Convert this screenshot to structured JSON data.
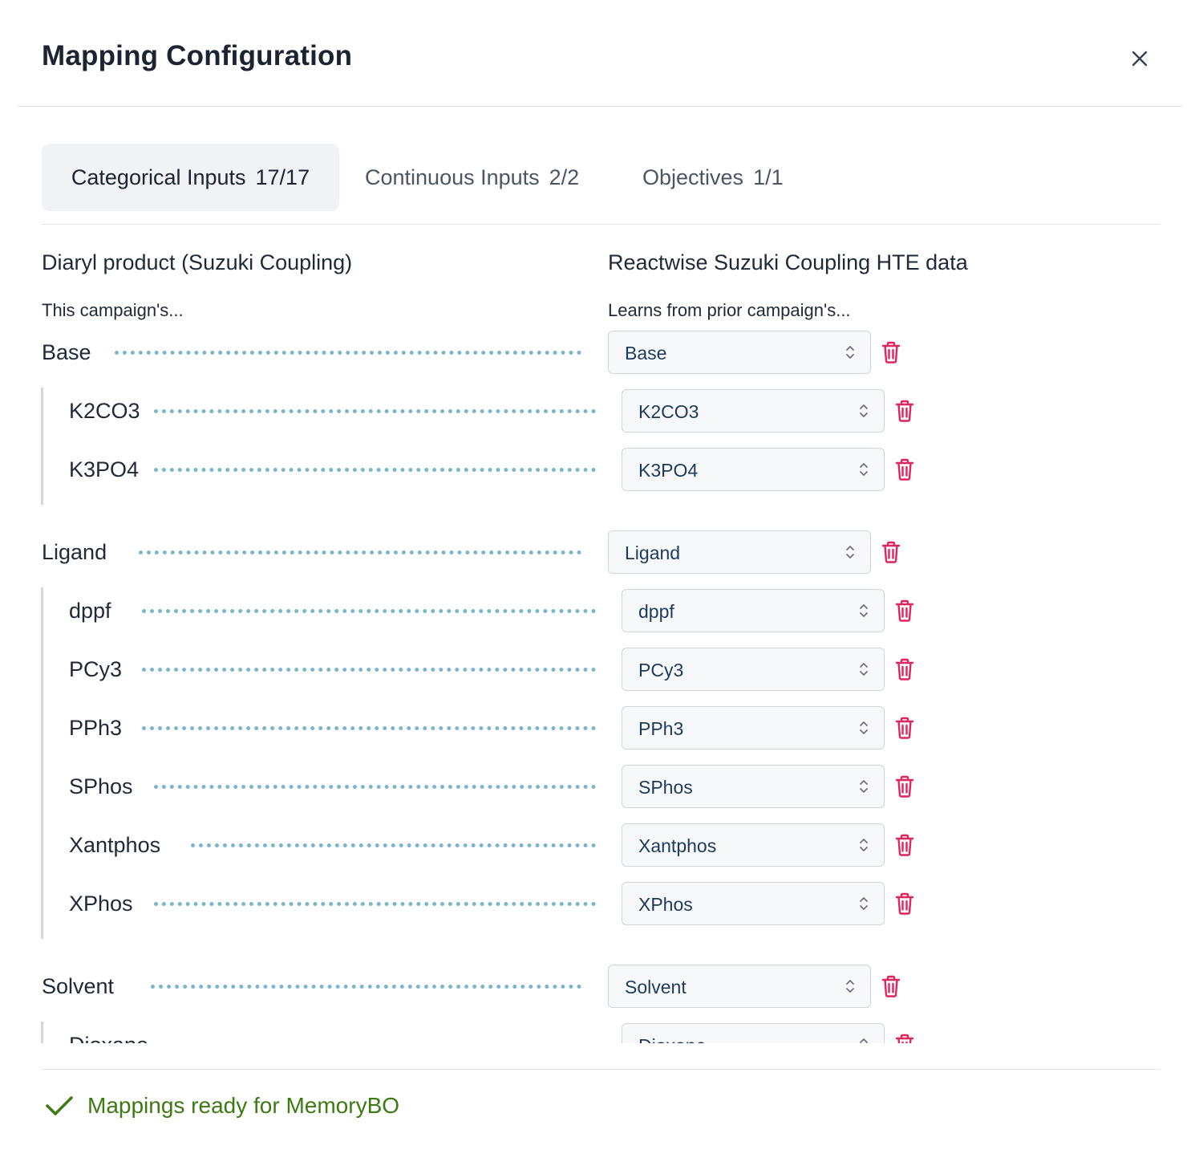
{
  "dialog": {
    "title": "Mapping Configuration",
    "close_icon": "close-icon"
  },
  "tabs": [
    {
      "label": "Categorical Inputs",
      "count": "17/17",
      "active": true
    },
    {
      "label": "Continuous Inputs",
      "count": "2/2",
      "active": false
    },
    {
      "label": "Objectives",
      "count": "1/1",
      "active": false
    }
  ],
  "left_column": {
    "title": "Diaryl product (Suzuki Coupling)",
    "subtitle": "This campaign's..."
  },
  "right_column": {
    "title": "Reactwise Suzuki Coupling HTE data",
    "subtitle": "Learns from prior campaign's..."
  },
  "groups": [
    {
      "label": "Base",
      "mapped": "Base",
      "items": [
        {
          "label": "K2CO3",
          "mapped": "K2CO3"
        },
        {
          "label": "K3PO4",
          "mapped": "K3PO4"
        }
      ]
    },
    {
      "label": "Ligand",
      "mapped": "Ligand",
      "items": [
        {
          "label": "dppf",
          "mapped": "dppf"
        },
        {
          "label": "PCy3",
          "mapped": "PCy3"
        },
        {
          "label": "PPh3",
          "mapped": "PPh3"
        },
        {
          "label": "SPhos",
          "mapped": "SPhos"
        },
        {
          "label": "Xantphos",
          "mapped": "Xantphos"
        },
        {
          "label": "XPhos",
          "mapped": "XPhos"
        }
      ]
    },
    {
      "label": "Solvent",
      "mapped": "Solvent",
      "items": [
        {
          "label": "Dioxane",
          "mapped": "Dioxane"
        }
      ]
    }
  ],
  "footer": {
    "status_text": "Mappings ready for MemoryBO",
    "status_icon": "check-icon"
  },
  "colors": {
    "connector": "#7bb6cc",
    "delete": "#e0245e",
    "success": "#3d7a13",
    "select_text": "#1d3a5c"
  }
}
